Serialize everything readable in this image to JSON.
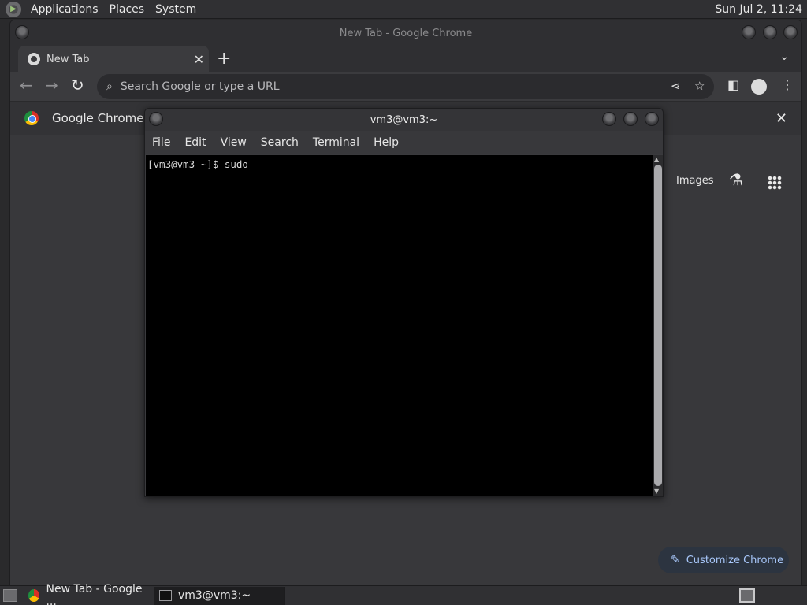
{
  "top_panel": {
    "menus": [
      "Applications",
      "Places",
      "System"
    ],
    "clock": "Sun Jul  2, 11:24"
  },
  "chrome": {
    "window_title": "New Tab - Google Chrome",
    "tab_title": "New Tab",
    "omnibox_placeholder": "Search Google or type a URL",
    "infobar_text": "Google Chrome isn",
    "ntp": {
      "images_link": "Images",
      "customize_button": "Customize Chrome"
    }
  },
  "terminal": {
    "window_title": "vm3@vm3:~",
    "menus": [
      "File",
      "Edit",
      "View",
      "Search",
      "Terminal",
      "Help"
    ],
    "content": "[vm3@vm3 ~]$ sudo"
  },
  "taskbar": {
    "tasks": [
      "New Tab - Google ...",
      "vm3@vm3:~"
    ]
  },
  "icons": {
    "back": "back-arrow-icon",
    "forward": "forward-arrow-icon",
    "reload": "reload-icon",
    "share": "share-icon",
    "bookmark": "star-icon",
    "side_panel": "side-panel-icon",
    "profile": "profile-icon",
    "menu": "kebab-menu-icon"
  }
}
